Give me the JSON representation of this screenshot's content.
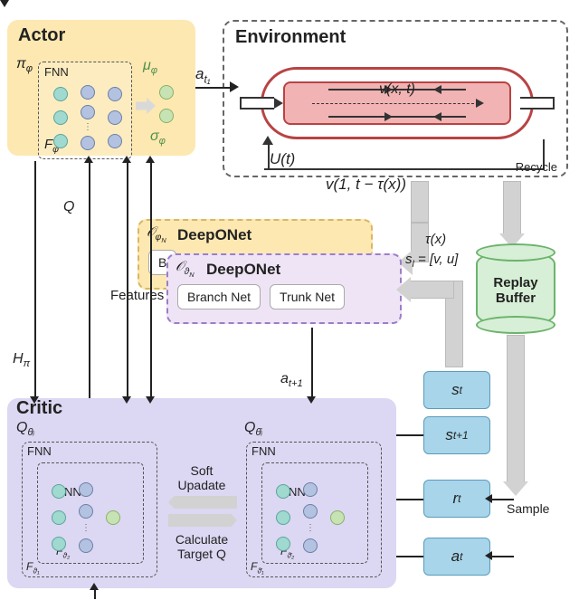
{
  "actor": {
    "title": "Actor",
    "policy": "π_φ",
    "fnn": "FNN",
    "F": "F_φ",
    "mu": "μ_φ",
    "sigma": "σ_φ"
  },
  "env": {
    "title": "Environment",
    "vxt": "v(x, t)",
    "Ut": "U(t)",
    "v1t": "v(1, t − τ(x))",
    "recycle": "Recycle"
  },
  "arrow_at1": "a_t₁",
  "tau": "τ(x)",
  "sl": "s_l = [v, u]",
  "deeponet_back": {
    "O": "𝒪_φ_N",
    "title": "DeepONet",
    "branch": "B"
  },
  "deeponet": {
    "O": "𝒪_ϑ_N",
    "title": "DeepONet",
    "branch": "Branch Net",
    "trunk": "Trunk Net"
  },
  "features": "Features",
  "buffer": {
    "l1": "Replay",
    "l2": "Buffer"
  },
  "state": {
    "st": "s_t",
    "st1": "s_{t+1}",
    "rt": "r_t",
    "at": "a_t"
  },
  "critic": {
    "title": "Critic",
    "Q": "Q_θᵢ",
    "Qbar": "Q_θ̄ᵢ",
    "fnn": "FNN",
    "F1": "F_ϑ₁",
    "F2": "F_ϑ₂",
    "F1b": "F_ϑ̄₁",
    "F2b": "F_ϑ̄₂",
    "soft": "Soft\nUpadate",
    "calc": "Calculate\nTarget Q"
  },
  "Hpi": "H_π",
  "Qsym": "Q",
  "at1plus": "a_{t+1}",
  "sample": "Sample"
}
